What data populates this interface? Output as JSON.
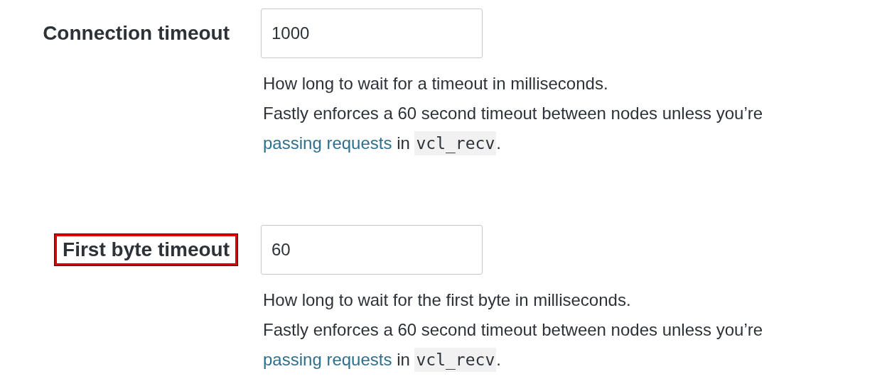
{
  "fields": [
    {
      "label": "Connection timeout",
      "highlighted": false,
      "value": "1000",
      "help": {
        "lines": [
          "How long to wait for a timeout in milliseconds.",
          "Fastly enforces a 60 second timeout between nodes unless you’re"
        ],
        "link": "passing requests",
        "connector": "in",
        "code": "vcl_recv",
        "end": "."
      }
    },
    {
      "label": "First byte timeout",
      "highlighted": true,
      "value": "60",
      "help": {
        "lines": [
          "How long to wait for the first byte in milliseconds.",
          "Fastly enforces a 60 second timeout between nodes unless you’re"
        ],
        "link": "passing requests",
        "connector": "in",
        "code": "vcl_recv",
        "end": "."
      }
    }
  ]
}
